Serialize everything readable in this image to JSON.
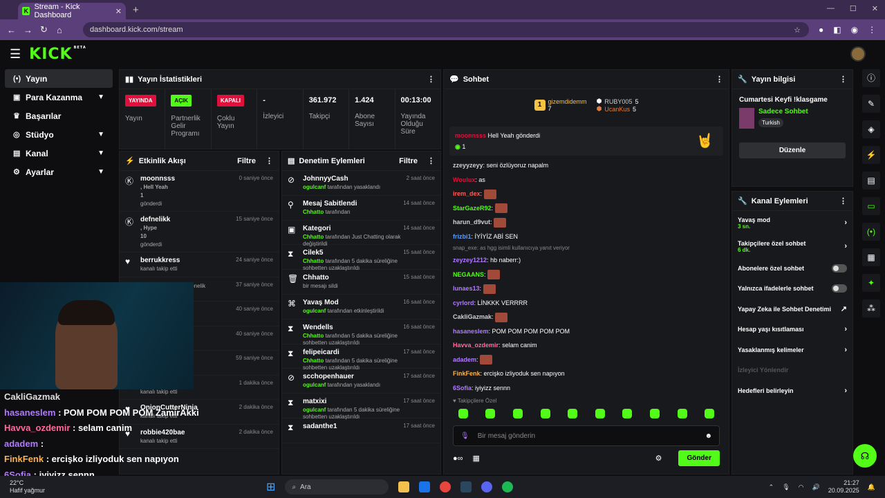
{
  "browser": {
    "tab_title": "Stream - Kick Dashboard",
    "url": "dashboard.kick.com/stream"
  },
  "brand": {
    "logo": "KICK",
    "beta": "BETA",
    "accent": "#53fc18"
  },
  "sidebar": {
    "items": [
      {
        "label": "Yayın"
      },
      {
        "label": "Para Kazanma"
      },
      {
        "label": "Başarılar"
      },
      {
        "label": "Stüdyo"
      },
      {
        "label": "Kanal"
      },
      {
        "label": "Ayarlar"
      }
    ]
  },
  "stats": {
    "title": "Yayın İstatistikleri",
    "cells": [
      {
        "badge": "YAYINDA",
        "label": "Yayın"
      },
      {
        "badge": "AÇIK",
        "label": "Partnerlik Gelir Programı"
      },
      {
        "badge": "KAPALI",
        "label": "Çoklu Yayın"
      },
      {
        "value": "-",
        "label": "İzleyici"
      },
      {
        "value": "361.972",
        "label": "Takipçi"
      },
      {
        "value": "1.424",
        "label": "Abone Sayısı"
      },
      {
        "value": "00:13:00",
        "label": "Yayında Olduğu Süre"
      }
    ]
  },
  "feed": {
    "title": "Etkinlik Akışı",
    "filter": "Filtre",
    "rows": [
      {
        "name": "moonnsss",
        "extra": ", Hell Yeah",
        "count": "1",
        "sub": "gönderdi",
        "time": "0 saniye önce"
      },
      {
        "name": "defnelikk",
        "extra": ", Hype",
        "count": "10",
        "sub": "gönderdi",
        "time": "15 saniye önce"
      },
      {
        "name": "berrukkress",
        "sub": "kanalı takip etti",
        "time": "24 saniye önce"
      },
      {
        "name": "",
        "sub": "i kutluyor! Toplam abonelik",
        "time": "37 saniye önce"
      },
      {
        "name": "",
        "sub": "",
        "time": "40 saniye önce"
      },
      {
        "name": "",
        "sub": "",
        "time": "40 saniye önce"
      },
      {
        "name": "",
        "sub": "kanalı takip etti",
        "time": "59 saniye önce"
      },
      {
        "name": "ZamirAkki",
        "sub": "kanalı takip etti",
        "time": "1 dakika önce"
      },
      {
        "name": "OnionCutterNinja",
        "sub": "kanalı takip etti",
        "time": "2 dakika önce"
      },
      {
        "name": "robbie420bae",
        "sub": "kanalı takip etti",
        "time": "2 dakika önce"
      }
    ]
  },
  "mod": {
    "title": "Denetim Eylemleri",
    "filter": "Filtre",
    "rows": [
      {
        "name": "JohnnyyCash",
        "actor": "ogulcanf",
        "sub": "tarafından yasaklandı",
        "time": "2 saat önce"
      },
      {
        "name": "Mesaj Sabitlendi",
        "actor": "Chhatto",
        "sub": "tarafından",
        "time": "14 saat önce"
      },
      {
        "name": "Kategori",
        "actor": "Chhatto",
        "sub": "tarafından Just Chatting olarak değiştirildi",
        "time": "14 saat önce"
      },
      {
        "name": "Cilek5",
        "actor": "Chhatto",
        "sub": "tarafından 5 dakika süreliğine sohbetten uzaklaştırıldı",
        "time": "15 saat önce"
      },
      {
        "name": "Chhatto",
        "actor": "",
        "sub": "bir mesajı sildi",
        "time": "15 saat önce"
      },
      {
        "name": "Yavaş Mod",
        "actor": "ogulcanf",
        "sub": "tarafından etkinleştirildi",
        "time": "16 saat önce"
      },
      {
        "name": "Wendells",
        "actor": "Chhatto",
        "sub": "tarafından 5 dakika süreliğine sohbetten uzaklaştırıldı",
        "time": "16 saat önce"
      },
      {
        "name": "felipeicardi",
        "actor": "Chhatto",
        "sub": "tarafından 5 dakika süreliğine sohbetten uzaklaştırıldı",
        "time": "17 saat önce"
      },
      {
        "name": "scchopenhauer",
        "actor": "ogulcanf",
        "sub": "tarafından yasaklandı",
        "time": "17 saat önce"
      },
      {
        "name": "matxixi",
        "actor": "ogulcanf",
        "sub": "tarafından 5 dakika süreliğine sohbetten uzaklaştırıldı",
        "time": "17 saat önce"
      },
      {
        "name": "sadanthe1",
        "actor": "",
        "sub": "",
        "time": "17 saat önce"
      }
    ]
  },
  "chat": {
    "title": "Sohbet",
    "leaders": [
      {
        "rank": "1",
        "name": "gizemdidemm",
        "count": "7"
      },
      {
        "name": "RUBY005",
        "count": "5"
      },
      {
        "name": "UcanKus",
        "count": "5"
      }
    ],
    "pinned": {
      "user": "moonnsss",
      "text": "Hell Yeah gönderdi",
      "count": "1"
    },
    "messages": [
      {
        "user": "zzeyyzeyy",
        "color": "#cfcfcf",
        "text": "seni özlüyoruz napalm"
      },
      {
        "user": "Woulux",
        "color": "#e0103c",
        "text": "as"
      },
      {
        "user": "irem_dex",
        "color": "#ff5a5a",
        "text": "",
        "emote": true
      },
      {
        "user": "StarGazeR92",
        "color": "#53fc18",
        "text": "",
        "emote": true
      },
      {
        "user": "harun_d9vut",
        "color": "#cfcfcf",
        "text": "",
        "emote": true
      },
      {
        "user": "frizbi1",
        "color": "#5a9cff",
        "text": "İYİYİZ ABİ SEN"
      },
      {
        "user": "zeyzey1212",
        "color": "#b07aff",
        "text": "hb naberr:)",
        "reply": "snap_exe: as hgg isimli kullanıcıya yanıt veriyor"
      },
      {
        "user": "NEGAANS",
        "color": "#53fc18",
        "text": "",
        "emote": true
      },
      {
        "user": "lunaes13",
        "color": "#b07aff",
        "text": "",
        "emote": true
      },
      {
        "user": "cyrlord",
        "color": "#b07aff",
        "text": "LİNKKK VERRRR"
      },
      {
        "user": "CakliGazmak",
        "color": "#cfcfcf",
        "text": "",
        "emote": true
      },
      {
        "user": "hasaneslem",
        "color": "#b07aff",
        "text": "POM POM POM POM POM"
      },
      {
        "user": "Havva_ozdemir",
        "color": "#ff6a9a",
        "text": "selam canim"
      },
      {
        "user": "adadem",
        "color": "#b07aff",
        "text": "",
        "emote": true
      },
      {
        "user": "FinkFenk",
        "color": "#ffb347",
        "text": "ercişko izliyoduk sen napıyon"
      },
      {
        "user": "6Sofia",
        "color": "#b07aff",
        "text": "iyiyizz sennn"
      }
    ],
    "followers_only": "Takipçilere Özel",
    "input_placeholder": "Bir mesaj gönderin",
    "send_label": "Gönder"
  },
  "info": {
    "title": "Yayın bilgisi",
    "stream_title": "Cumartesi Keyfi !klasgame",
    "category": "Sadece Sohbet",
    "tag": "Turkish",
    "edit_label": "Düzenle"
  },
  "actions": {
    "title": "Kanal Eylemleri",
    "items": [
      {
        "label": "Yavaş mod",
        "sub": "3 sn.",
        "kind": "chev"
      },
      {
        "label": "Takipçilere özel sohbet",
        "sub": "6 dk.",
        "kind": "chev"
      },
      {
        "label": "Abonelere özel sohbet",
        "kind": "toggle"
      },
      {
        "label": "Yalnızca ifadelerle sohbet",
        "kind": "toggle"
      },
      {
        "label": "Yapay Zeka ile Sohbet Denetimi",
        "kind": "ext"
      },
      {
        "label": "Hesap yaşı kısıtlaması",
        "kind": "chev"
      },
      {
        "label": "Yasaklanmış kelimeler",
        "kind": "chev"
      },
      {
        "label": "İzleyici Yönlendir",
        "kind": "disabled"
      },
      {
        "label": "Hedefleri belirleyin",
        "kind": "chev"
      }
    ]
  },
  "overlay": {
    "lines": [
      {
        "user": "CakliGazmak",
        "color": "#dddddd",
        "text": ""
      },
      {
        "user": "hasaneslem",
        "color": "#b07aff",
        "text": ": POM POM POM POM ZamirAkki"
      },
      {
        "user": "Havva_ozdemir",
        "color": "#ff6a9a",
        "text": ": selam canim"
      },
      {
        "user": "adadem",
        "color": "#b07aff",
        "text": ":"
      },
      {
        "user": "FinkFenk",
        "color": "#ffb347",
        "text": ": ercişko izliyoduk sen napıyon"
      },
      {
        "user": "6Sofia",
        "color": "#b07aff",
        "text": ": iyiyizz sennn"
      }
    ]
  },
  "taskbar": {
    "temp": "22°C",
    "weather": "Hafif yağmur",
    "search": "Ara",
    "time": "21:27",
    "date": "20.09.2025"
  }
}
